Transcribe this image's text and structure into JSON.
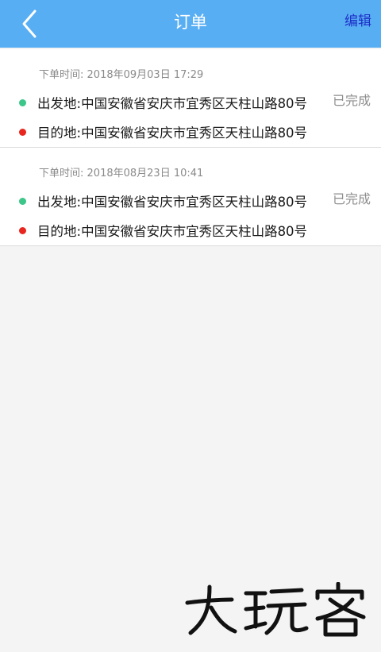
{
  "header": {
    "title": "订单",
    "edit_label": "编辑",
    "back_icon": "chevron-left-icon",
    "background": "#58aef3"
  },
  "orders": [
    {
      "time_label": "下单时间:",
      "time_value": "2018年09月03日 17:29",
      "from_label": "出发地:",
      "from_value": "中国安徽省安庆市宜秀区天柱山路80号",
      "to_label": "目的地:",
      "to_value": "中国安徽省安庆市宜秀区天柱山路80号",
      "status": "已完成"
    },
    {
      "time_label": "下单时间:",
      "time_value": "2018年08月23日 10:41",
      "from_label": "出发地:",
      "from_value": "中国安徽省安庆市宜秀区天柱山路80号",
      "to_label": "目的地:",
      "to_value": "中国安徽省安庆市宜秀区天柱山路80号",
      "status": "已完成"
    }
  ],
  "colors": {
    "from_dot": "#3cc68a",
    "to_dot": "#e8261f",
    "status_text": "#8e8e8e"
  },
  "watermark": {
    "text": "大玩客"
  }
}
